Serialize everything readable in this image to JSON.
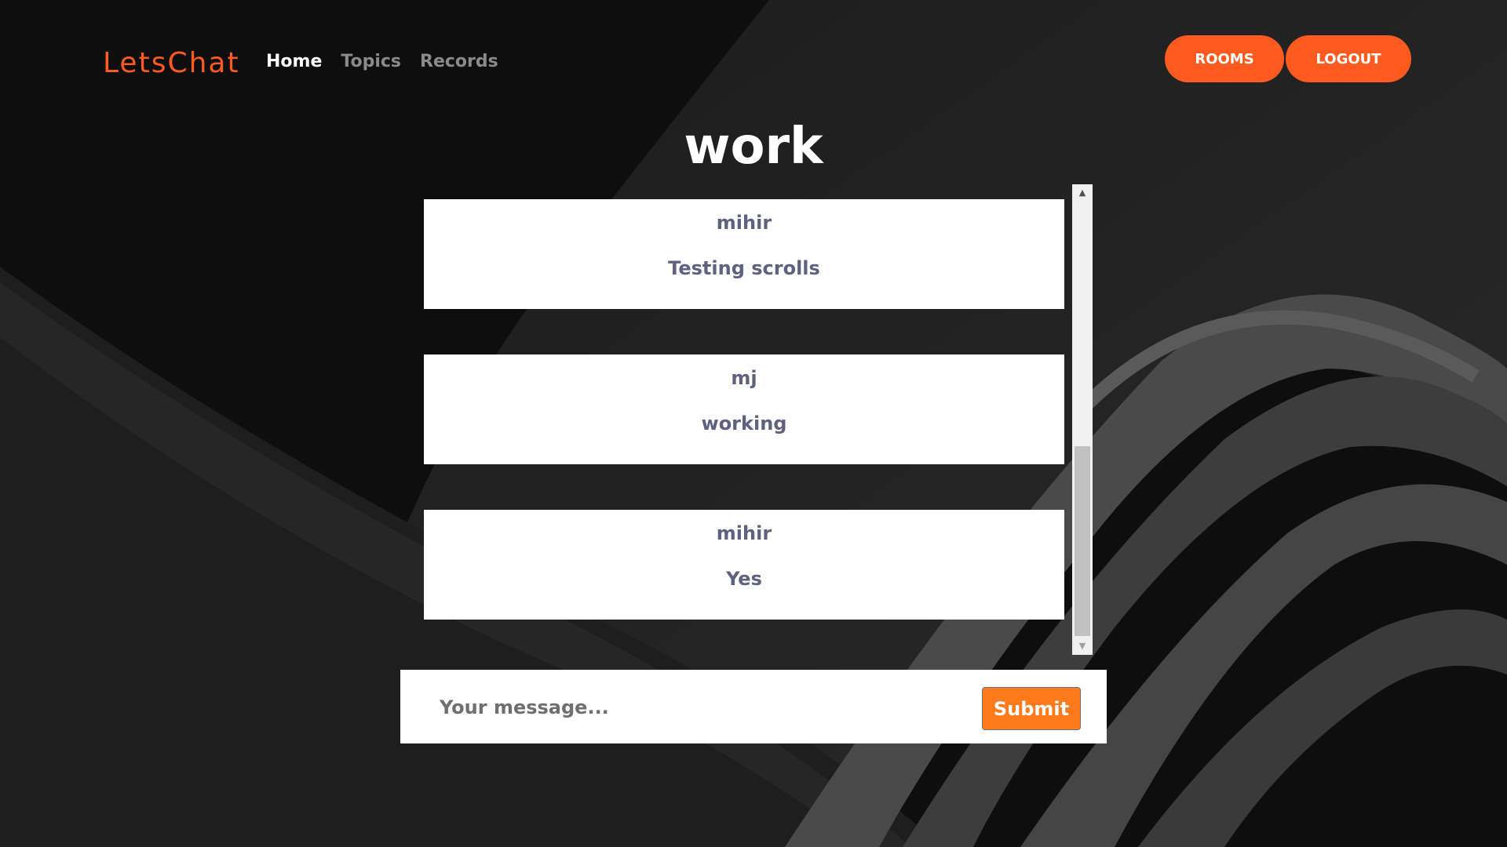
{
  "brand": {
    "logo_text": "LetsChat",
    "accent_color": "#ff5a1f"
  },
  "nav": {
    "links": [
      {
        "label": "Home",
        "active": true
      },
      {
        "label": "Topics",
        "active": false
      },
      {
        "label": "Records",
        "active": false
      }
    ],
    "buttons": {
      "rooms_label": "ROOMS",
      "logout_label": "LOGOUT"
    }
  },
  "room": {
    "title": "work"
  },
  "messages": [
    {
      "user": "mihir",
      "text": "Testing scrolls"
    },
    {
      "user": "mj",
      "text": "working"
    },
    {
      "user": "mihir",
      "text": "Yes"
    }
  ],
  "composer": {
    "placeholder": "Your message...",
    "value": "",
    "submit_label": "Submit",
    "submit_color": "#ff7a1a"
  }
}
